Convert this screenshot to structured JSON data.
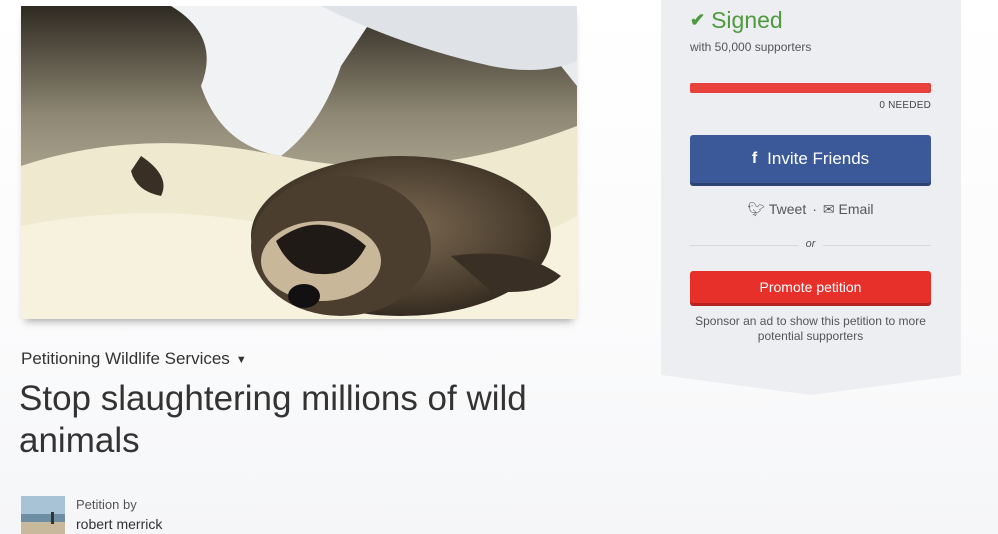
{
  "petition": {
    "target_text": "Petitioning Wildlife Services",
    "title": "Stop slaughtering millions of wild animals",
    "starter_label": "Petition by",
    "starter_name": "robert merrick"
  },
  "sidebar": {
    "status_text": "Signed",
    "supporters_text": "with 50,000 supporters",
    "progress_percent": 100,
    "needed_text": "0 NEEDED",
    "invite_label": "Invite Friends",
    "tweet_label": "Tweet",
    "email_label": "Email",
    "separator": "·",
    "or_text": "or",
    "promote_label": "Promote petition",
    "sponsor_text": "Sponsor an ad to show this petition to more potential supporters"
  },
  "colors": {
    "signed_green": "#4f9a3e",
    "progress_red": "#e8403a",
    "facebook_blue": "#3b5998",
    "promote_red": "#e7302a"
  }
}
